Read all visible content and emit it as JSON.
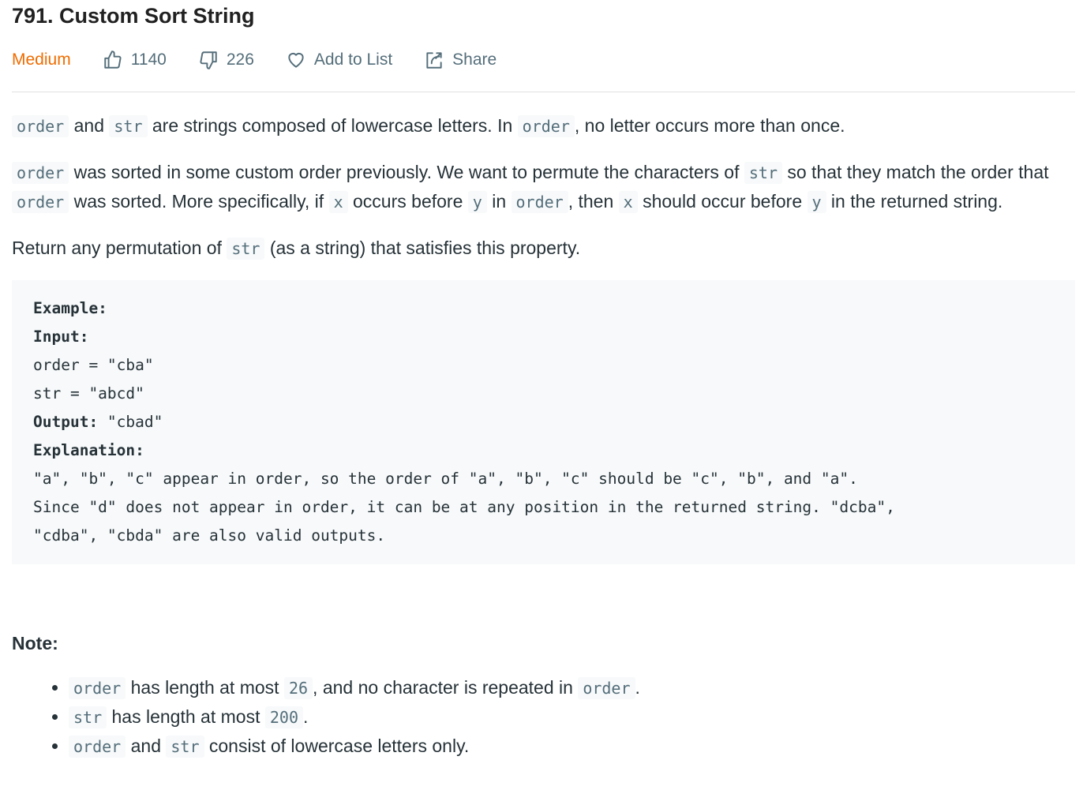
{
  "header": {
    "title": "791. Custom Sort String",
    "difficulty": "Medium",
    "likes": "1140",
    "dislikes": "226",
    "add_to_list": "Add to List",
    "share": "Share"
  },
  "description": {
    "p1": {
      "c1": "order",
      "t1": " and ",
      "c2": "str",
      "t2": " are strings composed of lowercase letters. In ",
      "c3": "order",
      "t3": ", no letter occurs more than once."
    },
    "p2": {
      "c1": "order",
      "t1": " was sorted in some custom order previously. We want to permute the characters of ",
      "c2": "str",
      "t2": " so that they match the order that ",
      "c3": "order",
      "t3": " was sorted. More specifically, if ",
      "c4": "x",
      "t4": " occurs before ",
      "c5": "y",
      "t5": " in ",
      "c6": "order",
      "t6": ", then ",
      "c7": "x",
      "t7": " should occur before ",
      "c8": "y",
      "t8": " in the returned string."
    },
    "p3": {
      "t1": "Return any permutation of ",
      "c1": "str",
      "t2": " (as a string) that satisfies this property."
    }
  },
  "example": {
    "heading": "Example:",
    "input_label": "Input:",
    "input_line1": "order = \"cba\"",
    "input_line2": "str = \"abcd\"",
    "output_label": "Output:",
    "output_value": " \"cbad\"",
    "explanation_label": "Explanation:",
    "explanation_line1": "\"a\", \"b\", \"c\" appear in order, so the order of \"a\", \"b\", \"c\" should be \"c\", \"b\", and \"a\".",
    "explanation_line2": "Since \"d\" does not appear in order, it can be at any position in the returned string. \"dcba\",",
    "explanation_line3": "\"cdba\", \"cbda\" are also valid outputs."
  },
  "note": {
    "title": "Note:",
    "items": [
      {
        "c1": "order",
        "t1": " has length at most ",
        "c2": "26",
        "t2": ", and no character is repeated in ",
        "c3": "order",
        "t3": "."
      },
      {
        "c1": "str",
        "t1": " has length at most ",
        "c2": "200",
        "t2": "."
      },
      {
        "c1": "order",
        "t1": " and ",
        "c2": "str",
        "t2": " consist of lowercase letters only."
      }
    ]
  }
}
